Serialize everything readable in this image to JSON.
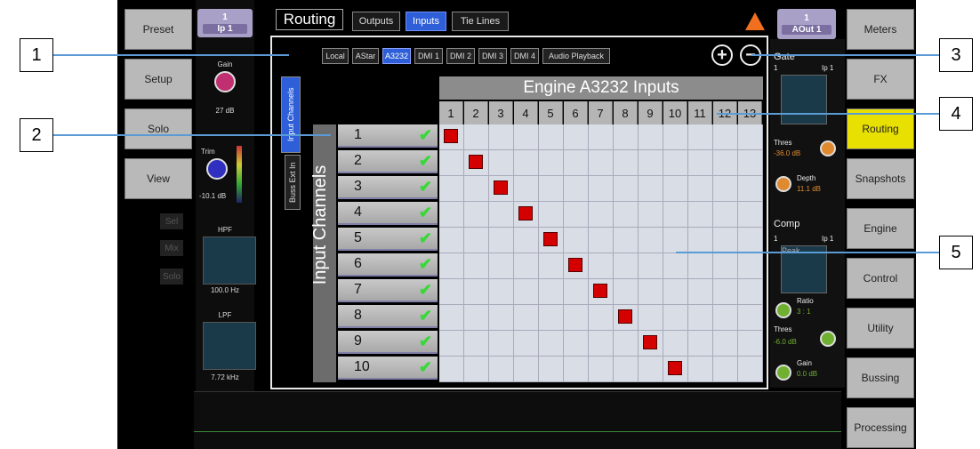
{
  "left_nav": [
    "Preset",
    "Setup",
    "Solo",
    "View"
  ],
  "channel": {
    "num": "1",
    "name": "Ip 1"
  },
  "gain": {
    "label": "Gain",
    "value": "27 dB"
  },
  "trim": {
    "label": "Trim",
    "value": "-10.1 dB"
  },
  "hpf": {
    "label": "HPF",
    "value": "100.0 Hz"
  },
  "lpf": {
    "label": "LPF",
    "value": "7.72 kHz"
  },
  "strip_buttons": [
    "Sel",
    "Mix",
    "Solo"
  ],
  "title": "Routing",
  "tabs": [
    {
      "label": "Outputs",
      "active": false
    },
    {
      "label": "Inputs",
      "active": true
    },
    {
      "label": "Tie Lines",
      "active": false
    }
  ],
  "right_channel": {
    "num": "1",
    "name": "AOut 1"
  },
  "right_nav": [
    {
      "label": "Meters"
    },
    {
      "label": "FX"
    },
    {
      "label": "Routing",
      "active": true
    },
    {
      "label": "Snapshots"
    },
    {
      "label": "Engine"
    },
    {
      "label": "Control"
    },
    {
      "label": "Utility"
    },
    {
      "label": "Bussing"
    },
    {
      "label": "Processing"
    }
  ],
  "sources": [
    {
      "label": "Local"
    },
    {
      "label": "AStar"
    },
    {
      "label": "A3232",
      "active": true
    },
    {
      "label": "DMI 1"
    },
    {
      "label": "DMI 2"
    },
    {
      "label": "DMI 3"
    },
    {
      "label": "DMI 4"
    },
    {
      "label": "Audio Playback"
    }
  ],
  "vtabs": [
    {
      "label": "Input Channels",
      "active": true
    },
    {
      "label": "Buss Ext In"
    }
  ],
  "grid": {
    "header": "Engine A3232 Inputs",
    "row_title": "Input Channels",
    "columns": [
      "1",
      "2",
      "3",
      "4",
      "5",
      "6",
      "7",
      "8",
      "9",
      "10",
      "11",
      "12",
      "13"
    ],
    "rows": [
      "1",
      "2",
      "3",
      "4",
      "5",
      "6",
      "7",
      "8",
      "9",
      "10"
    ]
  },
  "dyn": {
    "gate": "Gate",
    "gate_ch": "1",
    "gate_ip": "Ip 1",
    "thres_label": "Thres",
    "gate_thres": "-36.0 dB",
    "depth_label": "Depth",
    "depth": "11.1 dB",
    "comp": "Comp",
    "comp_ch": "1",
    "comp_ip": "Ip 1",
    "peak": "Peak",
    "ratio_label": "Ratio",
    "ratio": "3 : 1",
    "comp_thres": "-6.0 dB",
    "gain_label": "Gain",
    "gain": "0.0 dB"
  },
  "callouts": [
    "1",
    "2",
    "3",
    "4",
    "5"
  ],
  "colors": {
    "accent": "#2e5fd8",
    "routed": "#d40000",
    "active_nav": "#e8e000"
  }
}
